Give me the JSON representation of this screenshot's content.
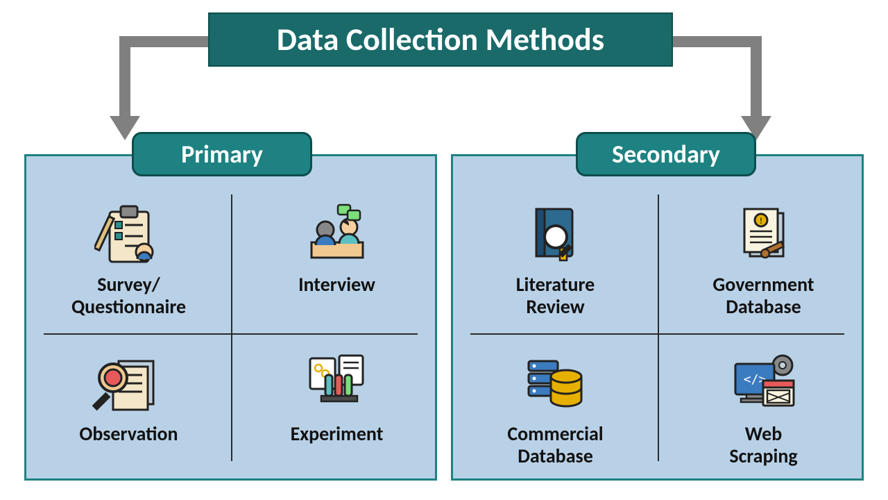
{
  "title": "Data Collection Methods",
  "categories": {
    "primary": {
      "label": "Primary",
      "items": [
        {
          "label": "Survey/\nQuestionnaire",
          "icon": "survey-icon"
        },
        {
          "label": "Interview",
          "icon": "interview-icon"
        },
        {
          "label": "Observation",
          "icon": "observation-icon"
        },
        {
          "label": "Experiment",
          "icon": "experiment-icon"
        }
      ]
    },
    "secondary": {
      "label": "Secondary",
      "items": [
        {
          "label": "Literature\nReview",
          "icon": "literature-icon"
        },
        {
          "label": "Government\nDatabase",
          "icon": "government-db-icon"
        },
        {
          "label": "Commercial\nDatabase",
          "icon": "commercial-db-icon"
        },
        {
          "label": "Web\nScraping",
          "icon": "web-scraping-icon"
        }
      ]
    }
  },
  "colors": {
    "title_bg": "#1a6a6a",
    "pill_bg": "#1d8281",
    "panel_bg": "#b9d1e6",
    "arrow": "#808080"
  }
}
